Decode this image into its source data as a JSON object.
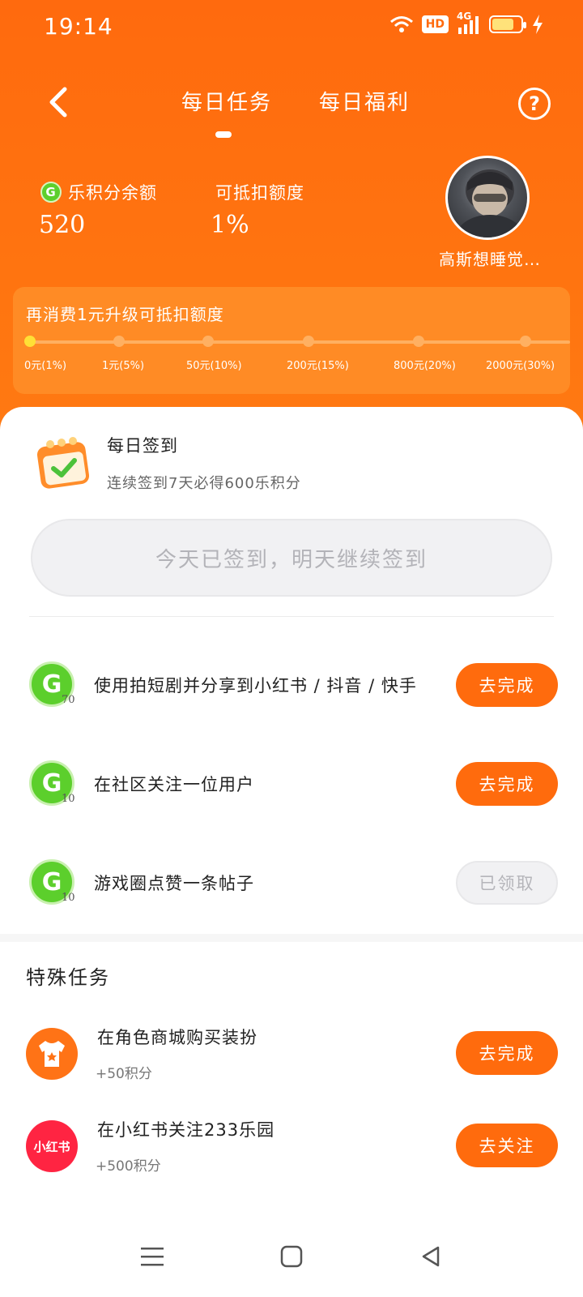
{
  "status": {
    "time": "19:14",
    "hd_badge": "HD",
    "network": "4G",
    "battery_level": 0.75
  },
  "header": {
    "tabs": [
      {
        "label": "每日任务",
        "active": true
      },
      {
        "label": "每日福利",
        "active": false
      }
    ],
    "help_label": "?"
  },
  "account": {
    "points_label": "乐积分余额",
    "points_value": "520",
    "deduct_label": "可抵扣额度",
    "deduct_value": "1%",
    "username": "高斯想睡觉…"
  },
  "upgrade": {
    "title": "再消费1元升级可抵扣额度",
    "progress_fraction": 0,
    "levels": [
      {
        "label": "0元(1%)",
        "active": true
      },
      {
        "label": "1元(5%)",
        "active": false
      },
      {
        "label": "50元(10%)",
        "active": false
      },
      {
        "label": "200元(15%)",
        "active": false
      },
      {
        "label": "800元(20%)",
        "active": false
      },
      {
        "label": "2000元(30%)",
        "active": false
      }
    ]
  },
  "checkin": {
    "title": "每日签到",
    "subtitle": "连续签到7天必得600乐积分",
    "button": "今天已签到，明天继续签到"
  },
  "daily_tasks": [
    {
      "label": "使用拍短剧并分享到小红书 / 抖音 / 快手",
      "points": "70",
      "button": "去完成",
      "claimed": false
    },
    {
      "label": "在社区关注一位用户",
      "points": "10",
      "button": "去完成",
      "claimed": false
    },
    {
      "label": "游戏圈点赞一条帖子",
      "points": "10",
      "button": "已领取",
      "claimed": true
    }
  ],
  "special": {
    "title": "特殊任务",
    "tasks": [
      {
        "label": "在角色商城购买装扮",
        "sub": "+50积分",
        "button": "去完成",
        "icon": "tshirt-icon",
        "icon_color": "#ff7316"
      },
      {
        "label": "在小红书关注233乐园",
        "sub": "+500积分",
        "button": "去关注",
        "icon": "xiaohongshu-icon",
        "icon_text": "小红书",
        "icon_color": "#ff2442"
      }
    ]
  },
  "colors": {
    "accent": "#ff6b0d",
    "header": "#ff6a0e",
    "coin": "#5ccf2c"
  }
}
